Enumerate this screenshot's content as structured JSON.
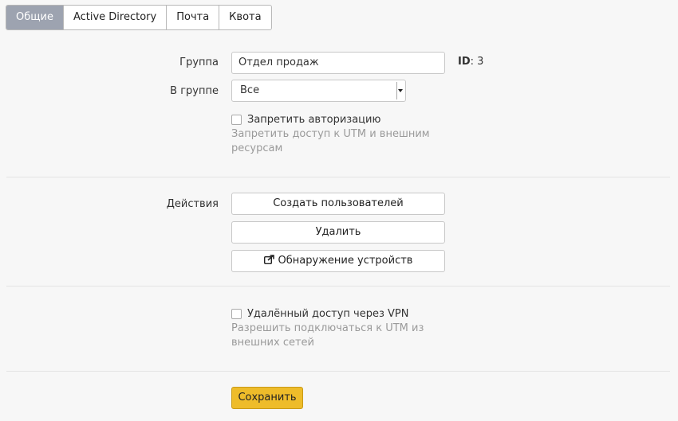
{
  "tabs": [
    {
      "label": "Общие"
    },
    {
      "label": "Active Directory"
    },
    {
      "label": "Почта"
    },
    {
      "label": "Квота"
    }
  ],
  "form": {
    "group_label": "Группа",
    "group_value": "Отдел продаж",
    "id_label": "ID",
    "id_value": ": 3",
    "parent_label": "В группе",
    "parent_value": "Все",
    "deny_auth_label": "Запретить авторизацию",
    "deny_auth_help": "Запретить доступ к UTM и внешним ресурсам",
    "actions_label": "Действия",
    "create_users": "Создать пользователей",
    "delete": "Удалить",
    "discover_devices": "Обнаружение устройств",
    "vpn_label": "Удалённый доступ через VPN",
    "vpn_help": "Разрешить подключаться к UTM из внешних сетей",
    "save": "Сохранить"
  },
  "icons": {
    "discover": "share-square-icon"
  },
  "colors": {
    "active_tab": "#9da3b0",
    "save_button": "#eebc2a"
  }
}
